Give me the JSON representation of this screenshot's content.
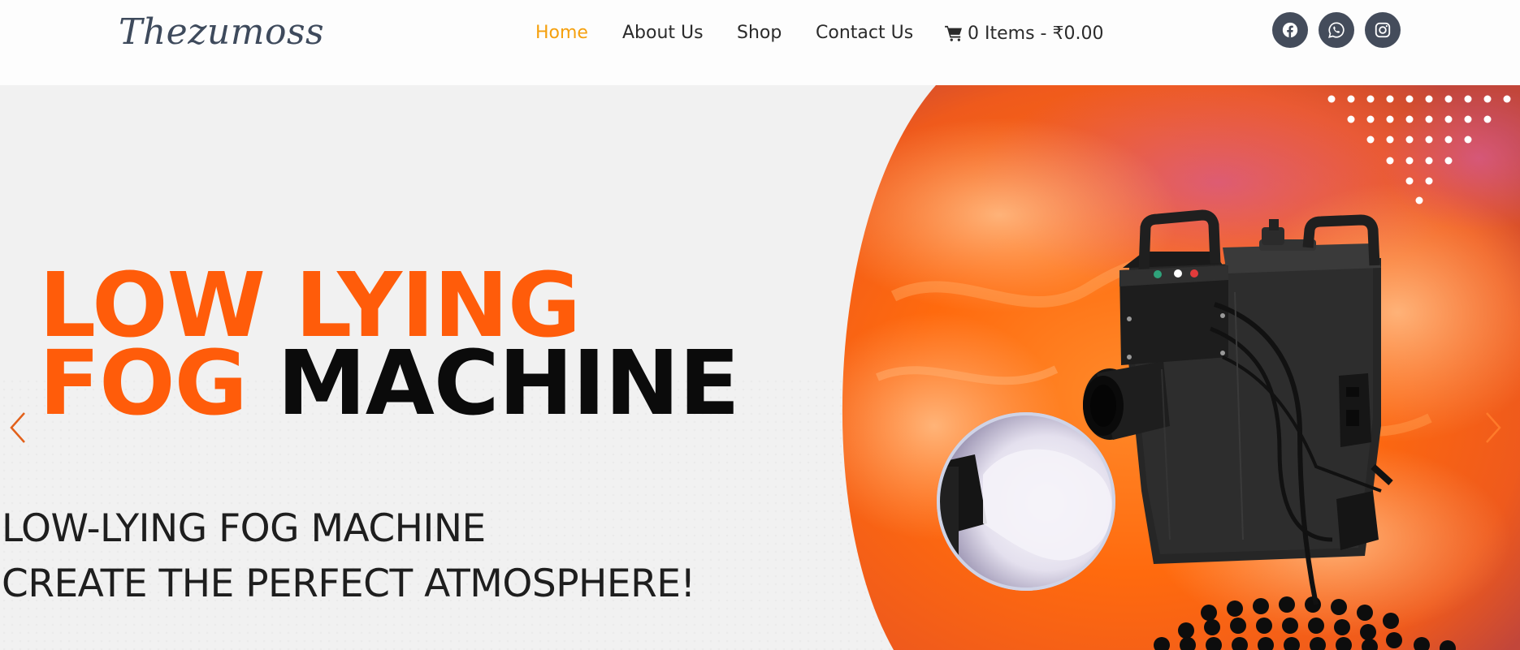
{
  "header": {
    "logo": "Thezumoss",
    "nav": [
      {
        "label": "Home",
        "active": true
      },
      {
        "label": "About Us",
        "active": false
      },
      {
        "label": "Shop",
        "active": false
      },
      {
        "label": "Contact Us",
        "active": false
      }
    ],
    "cart_label": "0 Items - ₹0.00",
    "social": [
      "facebook-icon",
      "whatsapp-icon",
      "instagram-icon"
    ]
  },
  "hero": {
    "headline_line1": "LOW LYING",
    "headline_word_orange": "FOG",
    "headline_word_black": "MACHINE",
    "subtitle_1": "LOW-LYING FOG MACHINE",
    "subtitle_2": "CREATE THE PERFECT ATMOSPHERE!",
    "image": "fog-machine-product-image"
  },
  "colors": {
    "accent_orange": "#ff5c0a",
    "nav_active": "#f5a00e",
    "social_bg": "#444c5b",
    "hero_bg": "#f1f1f1"
  }
}
